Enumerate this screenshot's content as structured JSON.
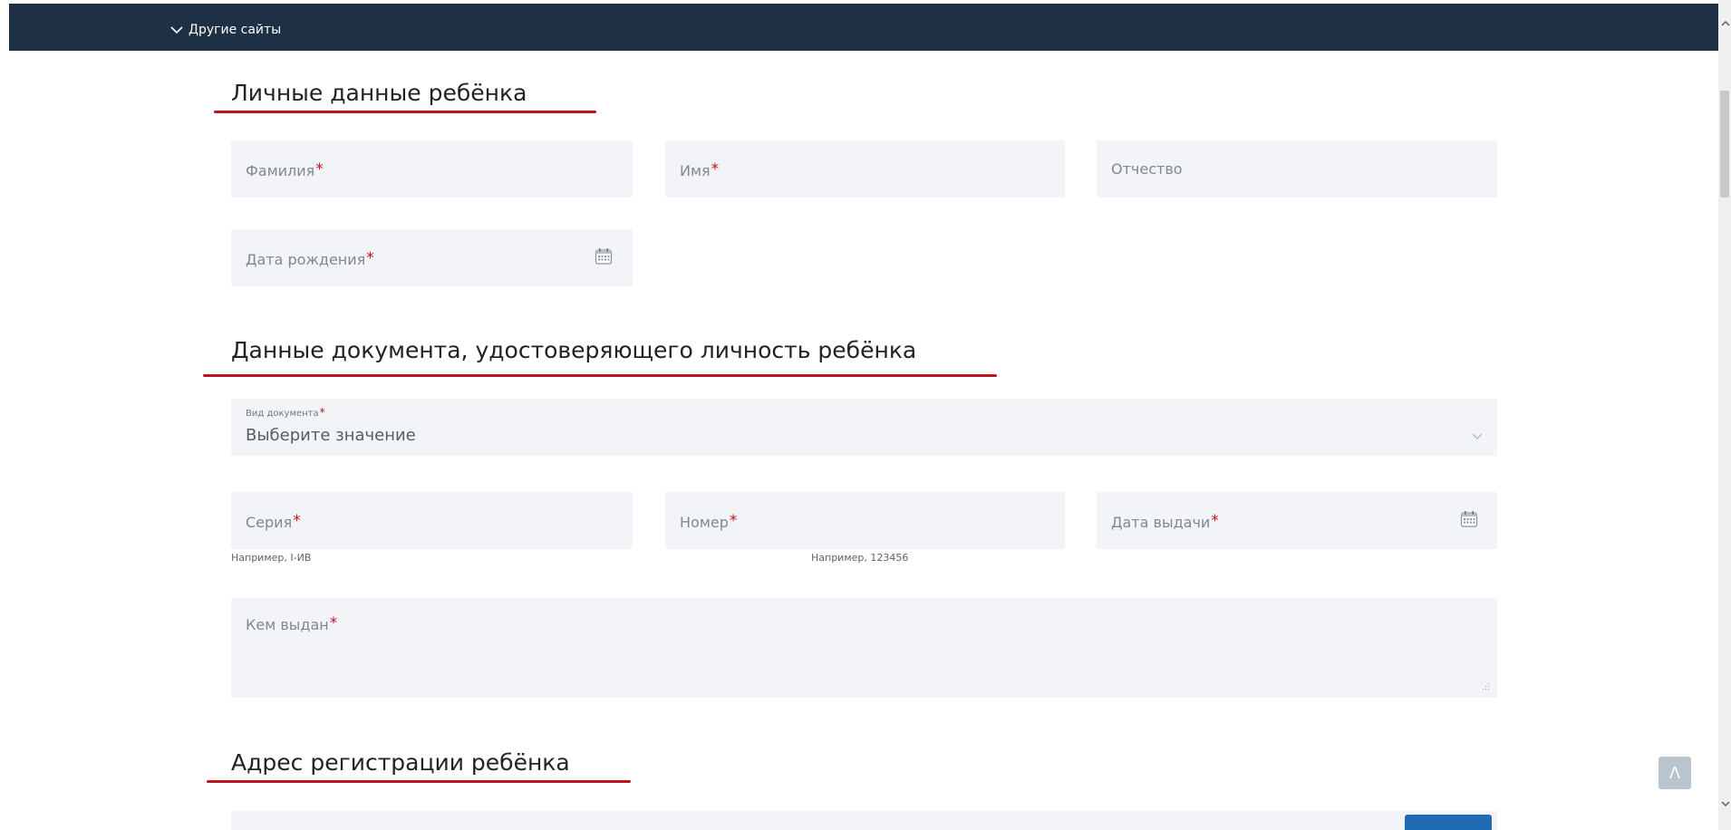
{
  "header": {
    "other_sites_label": "Другие сайты"
  },
  "sections": {
    "personal_title": "Личные данные ребёнка",
    "document_title": "Данные документа, удостоверяющего личность ребёнка",
    "address_title": "Адрес регистрации ребёнка"
  },
  "personal": {
    "surname_placeholder": "Фамилия",
    "name_placeholder": "Имя",
    "patronymic_placeholder": "Отчество",
    "birthdate_placeholder": "Дата рождения"
  },
  "document": {
    "type_label": "Вид документа",
    "type_value": "Выберите значение",
    "series_placeholder": "Серия",
    "series_hint": "Например, I-ИВ",
    "number_placeholder": "Номер",
    "number_hint": "Например, 123456",
    "issue_date_placeholder": "Дата выдачи",
    "issued_by_placeholder": "Кем выдан"
  },
  "required_mark": "*",
  "to_top_label": "Λ",
  "colors": {
    "header_bg": "#1e3044",
    "field_bg": "#f2f4f7",
    "required": "#c1121f",
    "underline": "#c1121f",
    "button_blue": "#1f6bb4"
  },
  "icons": [
    "chevron-down-icon",
    "calendar-icon",
    "resize-grip-icon",
    "arrow-up-icon"
  ]
}
